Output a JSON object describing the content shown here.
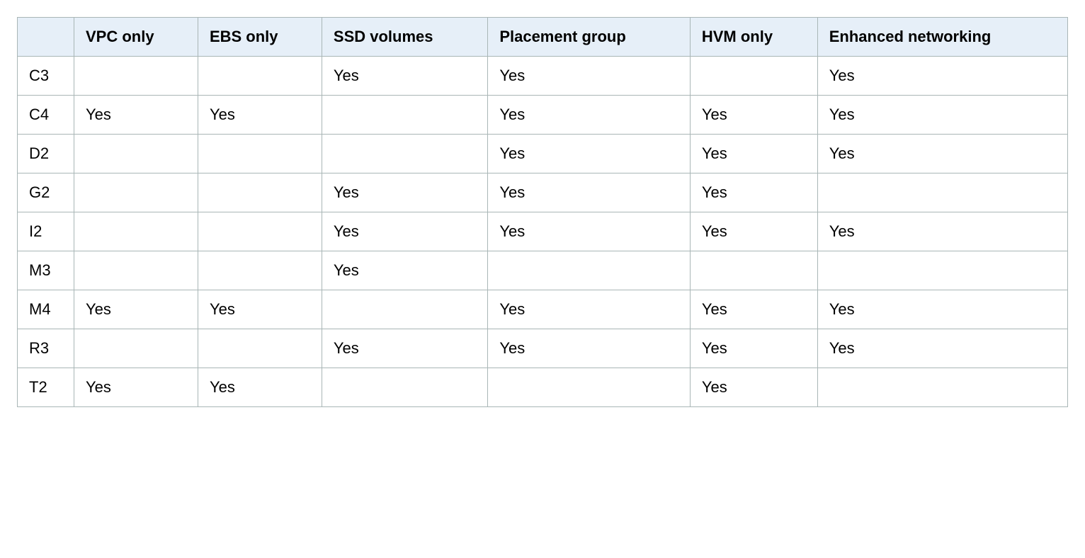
{
  "table": {
    "columns": [
      "VPC only",
      "EBS only",
      "SSD volumes",
      "Placement group",
      "HVM only",
      "Enhanced networking"
    ],
    "rows": [
      {
        "label": "C3",
        "cells": [
          "",
          "",
          "Yes",
          "Yes",
          "",
          "Yes"
        ]
      },
      {
        "label": "C4",
        "cells": [
          "Yes",
          "Yes",
          "",
          "Yes",
          "Yes",
          "Yes"
        ]
      },
      {
        "label": "D2",
        "cells": [
          "",
          "",
          "",
          "Yes",
          "Yes",
          "Yes"
        ]
      },
      {
        "label": "G2",
        "cells": [
          "",
          "",
          "Yes",
          "Yes",
          "Yes",
          ""
        ]
      },
      {
        "label": "I2",
        "cells": [
          "",
          "",
          "Yes",
          "Yes",
          "Yes",
          "Yes"
        ]
      },
      {
        "label": "M3",
        "cells": [
          "",
          "",
          "Yes",
          "",
          "",
          ""
        ]
      },
      {
        "label": "M4",
        "cells": [
          "Yes",
          "Yes",
          "",
          "Yes",
          "Yes",
          "Yes"
        ]
      },
      {
        "label": "R3",
        "cells": [
          "",
          "",
          "Yes",
          "Yes",
          "Yes",
          "Yes"
        ]
      },
      {
        "label": "T2",
        "cells": [
          "Yes",
          "Yes",
          "",
          "",
          "Yes",
          ""
        ]
      }
    ]
  }
}
